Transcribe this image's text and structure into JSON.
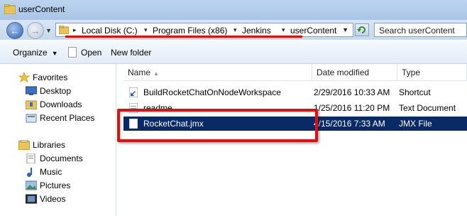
{
  "window": {
    "title": "userContent"
  },
  "address": {
    "breadcrumbs": [
      "Local Disk (C:)",
      "Program Files (x86)",
      "Jenkins",
      "userContent"
    ]
  },
  "search": {
    "placeholder": "Search userContent"
  },
  "toolbar": {
    "organize_label": "Organize",
    "open_label": "Open",
    "new_folder_label": "New folder"
  },
  "nav": {
    "favorites_label": "Favorites",
    "favorites": [
      "Desktop",
      "Downloads",
      "Recent Places"
    ],
    "libraries_label": "Libraries",
    "libraries": [
      "Documents",
      "Music",
      "Pictures",
      "Videos"
    ]
  },
  "columns": {
    "name": "Name",
    "date": "Date modified",
    "type": "Type"
  },
  "files": [
    {
      "name": "BuildRocketChatOnNodeWorkspace",
      "date": "2/29/2016 10:33 AM",
      "type": "Shortcut"
    },
    {
      "name": "readme",
      "date": "1/25/2016 11:20 PM",
      "type": "Text Document"
    },
    {
      "name": "RocketChat.jmx",
      "date": "4/15/2016 7:33 AM",
      "type": "JMX File"
    }
  ],
  "icons": {
    "title": "folder-icon",
    "back": "back-arrow-icon",
    "forward": "forward-arrow-icon",
    "refresh": "refresh-icon",
    "favorites": "star-icon",
    "libraries": "library-icon"
  },
  "colors": {
    "selection": "#0a2a66",
    "annotation": "#e01010"
  }
}
